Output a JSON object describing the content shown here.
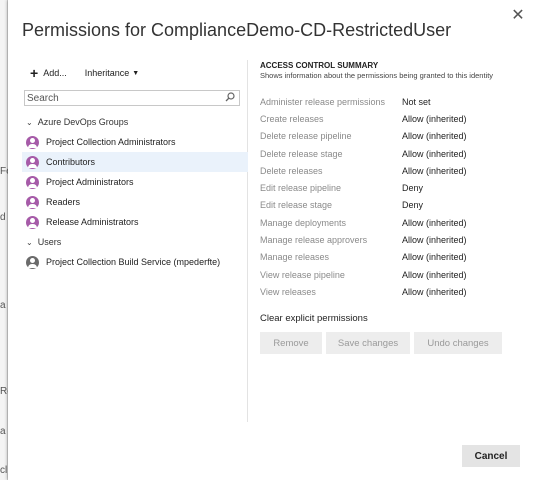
{
  "background": {
    "fragments": [
      "Fe",
      "d",
      "a",
      "Re",
      "a",
      "cl"
    ]
  },
  "dialog": {
    "title": "Permissions for ComplianceDemo-CD-RestrictedUser",
    "close_glyph": "✕",
    "cancel_label": "Cancel"
  },
  "toolbar": {
    "add_label": "Add...",
    "inheritance_label": "Inheritance"
  },
  "search": {
    "placeholder": "Search"
  },
  "tree": {
    "groups_header": "Azure DevOps Groups",
    "groups": [
      {
        "label": "Project Collection Administrators",
        "selected": false
      },
      {
        "label": "Contributors",
        "selected": true
      },
      {
        "label": "Project Administrators",
        "selected": false
      },
      {
        "label": "Readers",
        "selected": false
      },
      {
        "label": "Release Administrators",
        "selected": false
      }
    ],
    "users_header": "Users",
    "users": [
      {
        "label": "Project Collection Build Service (mpederfte)"
      }
    ]
  },
  "summary": {
    "title": "ACCESS CONTROL SUMMARY",
    "description": "Shows information about the permissions being granted to this identity"
  },
  "permissions": [
    {
      "name": "Administer release permissions",
      "value": "Not set"
    },
    {
      "name": "Create releases",
      "value": "Allow (inherited)"
    },
    {
      "name": "Delete release pipeline",
      "value": "Allow (inherited)"
    },
    {
      "name": "Delete release stage",
      "value": "Allow (inherited)"
    },
    {
      "name": "Delete releases",
      "value": "Allow (inherited)"
    },
    {
      "name": "Edit release pipeline",
      "value": "Deny"
    },
    {
      "name": "Edit release stage",
      "value": "Deny"
    },
    {
      "name": "Manage deployments",
      "value": "Allow (inherited)"
    },
    {
      "name": "Manage release approvers",
      "value": "Allow (inherited)"
    },
    {
      "name": "Manage releases",
      "value": "Allow (inherited)"
    },
    {
      "name": "View release pipeline",
      "value": "Allow (inherited)"
    },
    {
      "name": "View releases",
      "value": "Allow (inherited)"
    }
  ],
  "actions": {
    "clear_label": "Clear explicit permissions",
    "remove_label": "Remove",
    "save_label": "Save changes",
    "undo_label": "Undo changes"
  },
  "colors": {
    "group_avatar": "#a65ba8",
    "user_avatar": "#6b6b6b",
    "selected_row": "#eaf2fb"
  }
}
